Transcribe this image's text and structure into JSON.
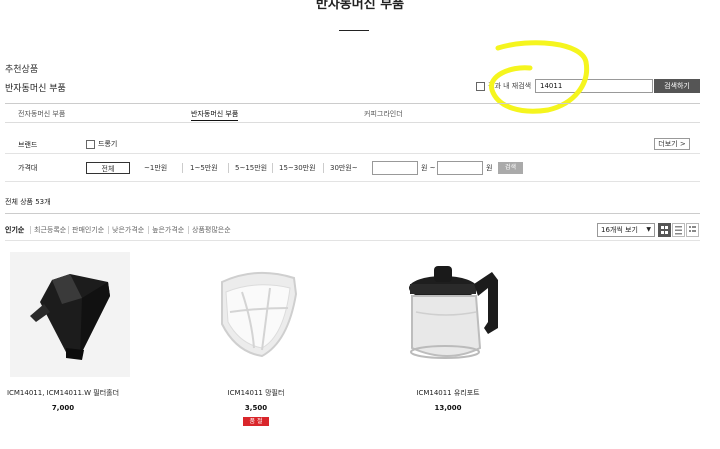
{
  "page_title": "반자동머신 부품",
  "recommend_label": "추천상품",
  "category_title": "반자동머신 부품",
  "search": {
    "rescan_label": "결과 내 재검색",
    "value": "14011",
    "button_label": "검색하기"
  },
  "tabs": [
    {
      "label": "전자동머신 부품",
      "active": false
    },
    {
      "label": "반자동머신 부품",
      "active": true
    },
    {
      "label": "커피그라인더",
      "active": false
    }
  ],
  "filters": {
    "brand_label": "브랜드",
    "brand_option": "드롱기",
    "more_label": "더보기 >",
    "price_label": "가격대",
    "price_options": [
      "전체",
      "~1만원",
      "1~5만원",
      "5~15만원",
      "15~30만원",
      "30만원~"
    ],
    "won_from": "원 ~",
    "won_to": "원",
    "apply_label": "검색"
  },
  "total_count": "전체 상품 53개",
  "sort_options": [
    "인기순",
    "최근등록순",
    "판매인기순",
    "낮은가격순",
    "높은가격순",
    "상품평많은순"
  ],
  "per_page": "16개씩 보기",
  "products": [
    {
      "name": "ICM14011, ICM14011.W 필터홀더",
      "price": "7,000",
      "badge": ""
    },
    {
      "name": "ICM14011 망필터",
      "price": "3,500",
      "badge": "품 절"
    },
    {
      "name": "ICM14011 유리포트",
      "price": "13,000",
      "badge": ""
    }
  ],
  "colors": {
    "highlight": "#f5f51e",
    "badge": "#d9262b",
    "search_button": "#555555"
  }
}
